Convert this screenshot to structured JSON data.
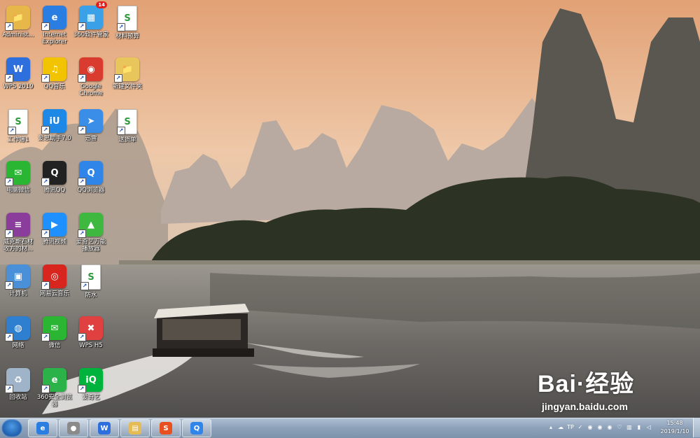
{
  "desktop": {
    "icons": [
      {
        "name": "administrator-folder",
        "label": "Administ...",
        "color": "#e7b74a",
        "glyph": "📁"
      },
      {
        "name": "internet-explorer",
        "label": "Internet\nExplorer",
        "color": "#2a7de1",
        "glyph": "e"
      },
      {
        "name": "360-software-manager",
        "label": "360软件管家",
        "color": "#3aa0e8",
        "glyph": "▦",
        "badge": "14"
      },
      {
        "name": "material-budget-file",
        "label": "材料预算",
        "color": "#ffffff",
        "glyph": "S"
      },
      {
        "name": "wps-2019",
        "label": "WPS 2019",
        "color": "#2d6fdd",
        "glyph": "W"
      },
      {
        "name": "qq-music",
        "label": "QQ音乐",
        "color": "#f2c300",
        "glyph": "♫"
      },
      {
        "name": "google-chrome",
        "label": "Google\nChrome",
        "color": "#d93c2f",
        "glyph": "◉"
      },
      {
        "name": "new-folder",
        "label": "新建文件夹",
        "color": "#e9c65c",
        "glyph": "📁"
      },
      {
        "name": "workbook-1",
        "label": "工作簿1",
        "color": "#ffffff",
        "glyph": "S"
      },
      {
        "name": "aisi-assistant",
        "label": "爱思助手7.0",
        "color": "#1d88e5",
        "glyph": "iU"
      },
      {
        "name": "xunlei",
        "label": "迅雷",
        "color": "#3b8ee8",
        "glyph": "➤"
      },
      {
        "name": "delivery-note",
        "label": "送货单",
        "color": "#ffffff",
        "glyph": "S"
      },
      {
        "name": "pc-wechat",
        "label": "电脑微信",
        "color": "#2ab533",
        "glyph": "✉"
      },
      {
        "name": "tencent-qq",
        "label": "腾讯QQ",
        "color": "#222222",
        "glyph": "Q"
      },
      {
        "name": "qq-browser",
        "label": "QQ浏览器",
        "color": "#2f86e8",
        "glyph": "Q"
      },
      {
        "name": "winrar-archive",
        "label": "威克斯石材\n收方的材...",
        "color": "#8a3d9b",
        "glyph": "≡"
      },
      {
        "name": "tencent-video",
        "label": "腾讯视频",
        "color": "#1e90ff",
        "glyph": "▶"
      },
      {
        "name": "iqiyi-player",
        "label": "爱奇艺万能\n播放器",
        "color": "#3fb83f",
        "glyph": "▲"
      },
      {
        "name": "computer",
        "label": "计算机",
        "color": "#4a90d9",
        "glyph": "▣"
      },
      {
        "name": "netease-music",
        "label": "网易云音乐",
        "color": "#d8261f",
        "glyph": "◎"
      },
      {
        "name": "waterproof-file",
        "label": "防水",
        "color": "#ffffff",
        "glyph": "S"
      },
      {
        "name": "network",
        "label": "网络",
        "color": "#2f7fd0",
        "glyph": "◍"
      },
      {
        "name": "wechat",
        "label": "微信",
        "color": "#2ab533",
        "glyph": "✉"
      },
      {
        "name": "wps-h5",
        "label": "WPS H5",
        "color": "#e04040",
        "glyph": "✖"
      },
      {
        "name": "recycle-bin",
        "label": "回收站",
        "color": "#9fb4c8",
        "glyph": "♻"
      },
      {
        "name": "360-browser",
        "label": "360安全浏览\n器",
        "color": "#2bb34a",
        "glyph": "e"
      },
      {
        "name": "iqiyi",
        "label": "爱奇艺",
        "color": "#00b33c",
        "glyph": "iQ"
      }
    ]
  },
  "watermark": {
    "logo": "Bai·经验",
    "url": "jingyan.baidu.com"
  },
  "taskbar": {
    "pinned": [
      {
        "name": "taskbar-internet-explorer",
        "color": "#2a7de1",
        "glyph": "e"
      },
      {
        "name": "taskbar-photo-viewer",
        "color": "#8a8a8a",
        "glyph": "●"
      },
      {
        "name": "taskbar-wps",
        "color": "#2d6fdd",
        "glyph": "W"
      },
      {
        "name": "taskbar-file-explorer",
        "color": "#e4bb55",
        "glyph": "▤"
      },
      {
        "name": "taskbar-sogou-input",
        "color": "#e8501f",
        "glyph": "S"
      },
      {
        "name": "taskbar-qq-browser",
        "color": "#2f86e8",
        "glyph": "Q"
      }
    ],
    "tray_icons": [
      "▴",
      "☁",
      "TP",
      "✓",
      "◉",
      "◉",
      "◉",
      "♡",
      "▥",
      "▮",
      "◁"
    ],
    "time": "15:48",
    "date": "2019/1/10"
  }
}
